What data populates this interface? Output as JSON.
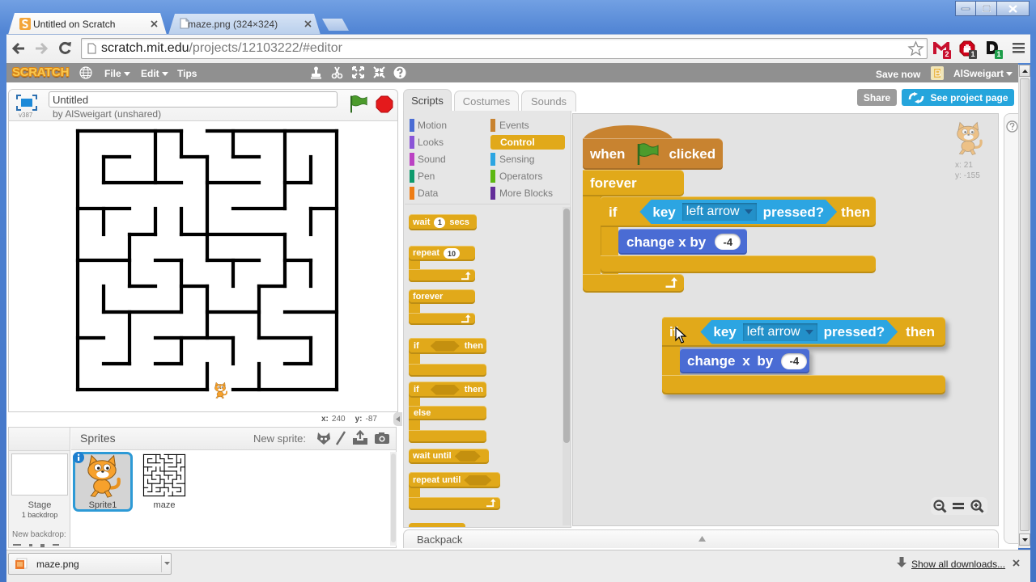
{
  "browser": {
    "tabs": [
      {
        "title": "Untitled on Scratch",
        "active": true
      },
      {
        "title": "maze.png (324×324)",
        "active": false
      }
    ],
    "address": {
      "host": "scratch.mit.edu",
      "path": "/projects/12103222/#editor"
    },
    "extensions": [
      {
        "name": "gmail",
        "badge": "2",
        "badge_color": "#c8102e"
      },
      {
        "name": "adblock",
        "badge": "1",
        "badge_color": "#444444"
      },
      {
        "name": "d-extension",
        "badge": "1",
        "badge_color": "#1e9e4a"
      }
    ]
  },
  "menubar": {
    "logo": "SCRATCH",
    "file": "File",
    "edit": "Edit",
    "tips": "Tips",
    "save_now": "Save now",
    "username": "AlSweigart"
  },
  "stage_header": {
    "version": "v387",
    "project_title": "Untitled",
    "byline": "by AlSweigart (unshared)"
  },
  "stage": {
    "mouse_x_label": "x:",
    "mouse_x": "240",
    "mouse_y_label": "y:",
    "mouse_y": "-87"
  },
  "sprites_pane": {
    "stage_label": "Stage",
    "backdrop_count": "1 backdrop",
    "new_backdrop_label": "New backdrop:",
    "header": "Sprites",
    "new_sprite_label": "New sprite:",
    "sprites": [
      {
        "name": "Sprite1",
        "selected": true
      },
      {
        "name": "maze",
        "selected": false
      }
    ]
  },
  "editor_tabs": [
    {
      "label": "Scripts",
      "active": true
    },
    {
      "label": "Costumes",
      "active": false
    },
    {
      "label": "Sounds",
      "active": false
    }
  ],
  "actions": {
    "share": "Share",
    "see_project_page": "See project page"
  },
  "categories": [
    {
      "label": "Motion",
      "color": "#4a6cd4"
    },
    {
      "label": "Looks",
      "color": "#8a55d7"
    },
    {
      "label": "Sound",
      "color": "#bb42c3"
    },
    {
      "label": "Pen",
      "color": "#0e9a6c"
    },
    {
      "label": "Data",
      "color": "#ee7d16"
    },
    {
      "label": "Events",
      "color": "#c88330"
    },
    {
      "label": "Control",
      "color": "#e1a91a",
      "selected": true
    },
    {
      "label": "Sensing",
      "color": "#2ca5e2"
    },
    {
      "label": "Operators",
      "color": "#5cb712"
    },
    {
      "label": "More Blocks",
      "color": "#632d99"
    }
  ],
  "palette": {
    "wait": {
      "label": "wait",
      "value": "1",
      "unit": "secs"
    },
    "repeat": {
      "label": "repeat",
      "value": "10"
    },
    "forever": {
      "label": "forever"
    },
    "if_then": {
      "if": "if",
      "then": "then"
    },
    "if_else": {
      "if": "if",
      "then": "then",
      "else": "else"
    },
    "wait_until": {
      "label": "wait until"
    },
    "repeat_until": {
      "label": "repeat until"
    }
  },
  "scripts": [
    {
      "hat": {
        "when": "when",
        "clicked": "clicked"
      },
      "forever": "forever",
      "if": {
        "if": "if",
        "then": "then"
      },
      "condition": {
        "key": "key",
        "option": "left arrow",
        "pressed": "pressed?"
      },
      "action": {
        "label": "change x by",
        "value": "-4"
      }
    },
    {
      "if": {
        "if": "if",
        "then": "then"
      },
      "condition": {
        "key": "key",
        "option": "left arrow",
        "pressed": "pressed?"
      },
      "action": {
        "label": "change x by",
        "value": "-4"
      }
    }
  ],
  "sprite_info": {
    "x_label": "x:",
    "x": "21",
    "y_label": "y:",
    "y": "-155"
  },
  "backpack": {
    "label": "Backpack"
  },
  "downloads": {
    "file": "maze.png",
    "show_all": "Show all downloads..."
  }
}
